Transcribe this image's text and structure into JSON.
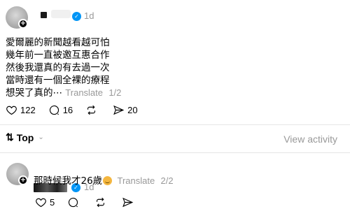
{
  "post": {
    "time": "1d",
    "lines": [
      "愛爾麗的新聞越看越可怕",
      "幾年前一直被邀互惠合作",
      "然後我還真的有去過一次",
      "當時還有一個全裸的療程",
      "想哭了真的⋯"
    ],
    "translate_label": "Translate",
    "pager": "1/2",
    "likes": "122",
    "comments": "16",
    "shares": "20"
  },
  "sort": {
    "label": "Top",
    "view_activity": "View activity"
  },
  "reply": {
    "time": "1d",
    "text": "那時候我才26歲",
    "translate_label": "Translate",
    "pager": "2/2",
    "likes": "5"
  },
  "icons": {
    "like": "heart-icon",
    "comment": "comment-bubble-icon",
    "repost": "repost-icon",
    "share": "share-send-icon",
    "verified": "verified-check-icon",
    "follow": "plus-icon",
    "sort": "sort-arrows-icon",
    "chevron": "chevron-down-icon"
  },
  "colors": {
    "verified_blue": "#0095f6",
    "muted_text": "#999999",
    "divider": "#e6e6e6"
  }
}
